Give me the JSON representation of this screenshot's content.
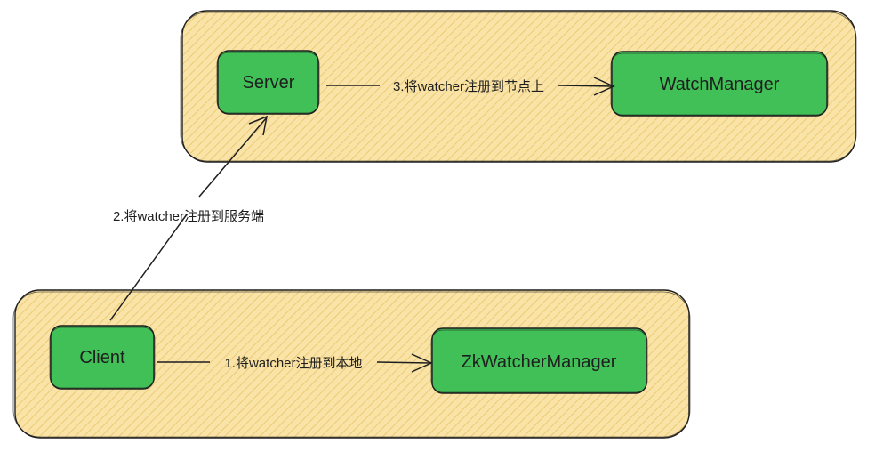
{
  "colors": {
    "container_fill": "#f9e3a6",
    "container_hatch": "#e9c46a",
    "node_fill": "#40c057",
    "stroke": "#1e1e1e",
    "background": "#ffffff"
  },
  "containers": [
    {
      "id": "server-side",
      "label": ""
    },
    {
      "id": "client-side",
      "label": ""
    }
  ],
  "nodes": {
    "server": "Server",
    "watch_manager": "WatchManager",
    "client": "Client",
    "zk_watcher_manager": "ZkWatcherManager"
  },
  "edges": {
    "client_to_local": "1.将watcher注册到本地",
    "client_to_server": "2.将watcher注册到服务端",
    "server_to_watch_manager": "3.将watcher注册到节点上"
  }
}
